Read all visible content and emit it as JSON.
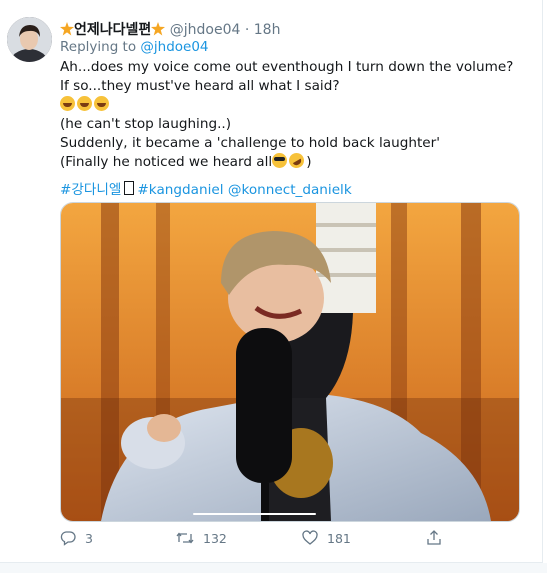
{
  "tweet": {
    "display_name": "언제나다넬편",
    "handle": "@jhdoe04",
    "separator": "·",
    "time": "18h",
    "replying_prefix": "Replying to",
    "replying_to": "@jhdoe04",
    "lines": [
      "Ah...does my voice come out eventhough I turn down the volume?",
      "If so...they must've heard all what I said?",
      "(he can't stop laughing..)",
      "Suddenly, it became a 'challenge to hold back laughter'",
      "(Finally he noticed we heard all"
    ],
    "line_end": ")",
    "hashtags": {
      "korean": "#강다니엘",
      "english": "#kangdaniel",
      "mention": "@konnect_danielk"
    },
    "counts": {
      "replies": "3",
      "retweets": "132",
      "likes": "181"
    }
  },
  "icons": [
    "star-icon",
    "reply-icon",
    "retweet-icon",
    "like-icon",
    "share-icon",
    "grinning-squinting-emoji",
    "sunglasses-emoji",
    "rofl-emoji"
  ],
  "colors": {
    "link": "#1b95e0",
    "muted": "#657786",
    "text": "#14171a",
    "star": "#f5a623"
  },
  "media": {
    "type": "video",
    "progress": 0.5
  }
}
